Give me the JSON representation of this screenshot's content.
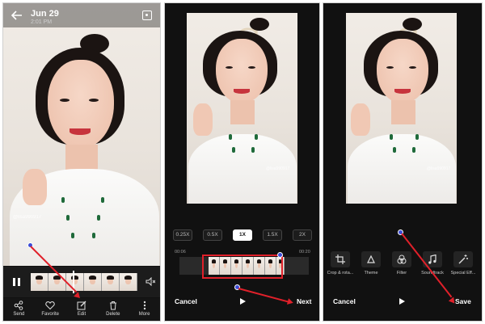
{
  "panel1": {
    "date": "Jun 29",
    "time": "2:01 PM",
    "watermark": "@lisa990917",
    "nav": [
      {
        "label": "Send",
        "icon": "share-icon"
      },
      {
        "label": "Favorite",
        "icon": "heart-icon"
      },
      {
        "label": "Edit",
        "icon": "edit-icon"
      },
      {
        "label": "Delete",
        "icon": "trash-icon"
      },
      {
        "label": "More",
        "icon": "more-icon"
      }
    ]
  },
  "panel2": {
    "speeds": [
      "0.25X",
      "0.5X",
      "1X",
      "1.5X",
      "2X"
    ],
    "selected_speed": "1X",
    "time_start": "00:06",
    "time_end": "00:20",
    "watermark": "@lisa990917",
    "cancel": "Cancel",
    "next": "Next"
  },
  "panel3": {
    "tools": [
      {
        "label": "Crop & rota...",
        "icon": "crop-icon"
      },
      {
        "label": "Theme",
        "icon": "theme-icon"
      },
      {
        "label": "Filter",
        "icon": "filter-icon"
      },
      {
        "label": "Soundtrack",
        "icon": "music-icon"
      },
      {
        "label": "Special Eff...",
        "icon": "magic-wand-icon"
      }
    ],
    "watermark": "@lisa990917",
    "cancel": "Cancel",
    "save": "Save"
  },
  "colors": {
    "annotation": "#e0202a",
    "marker": "#3b4bd6",
    "background": "#111111"
  }
}
